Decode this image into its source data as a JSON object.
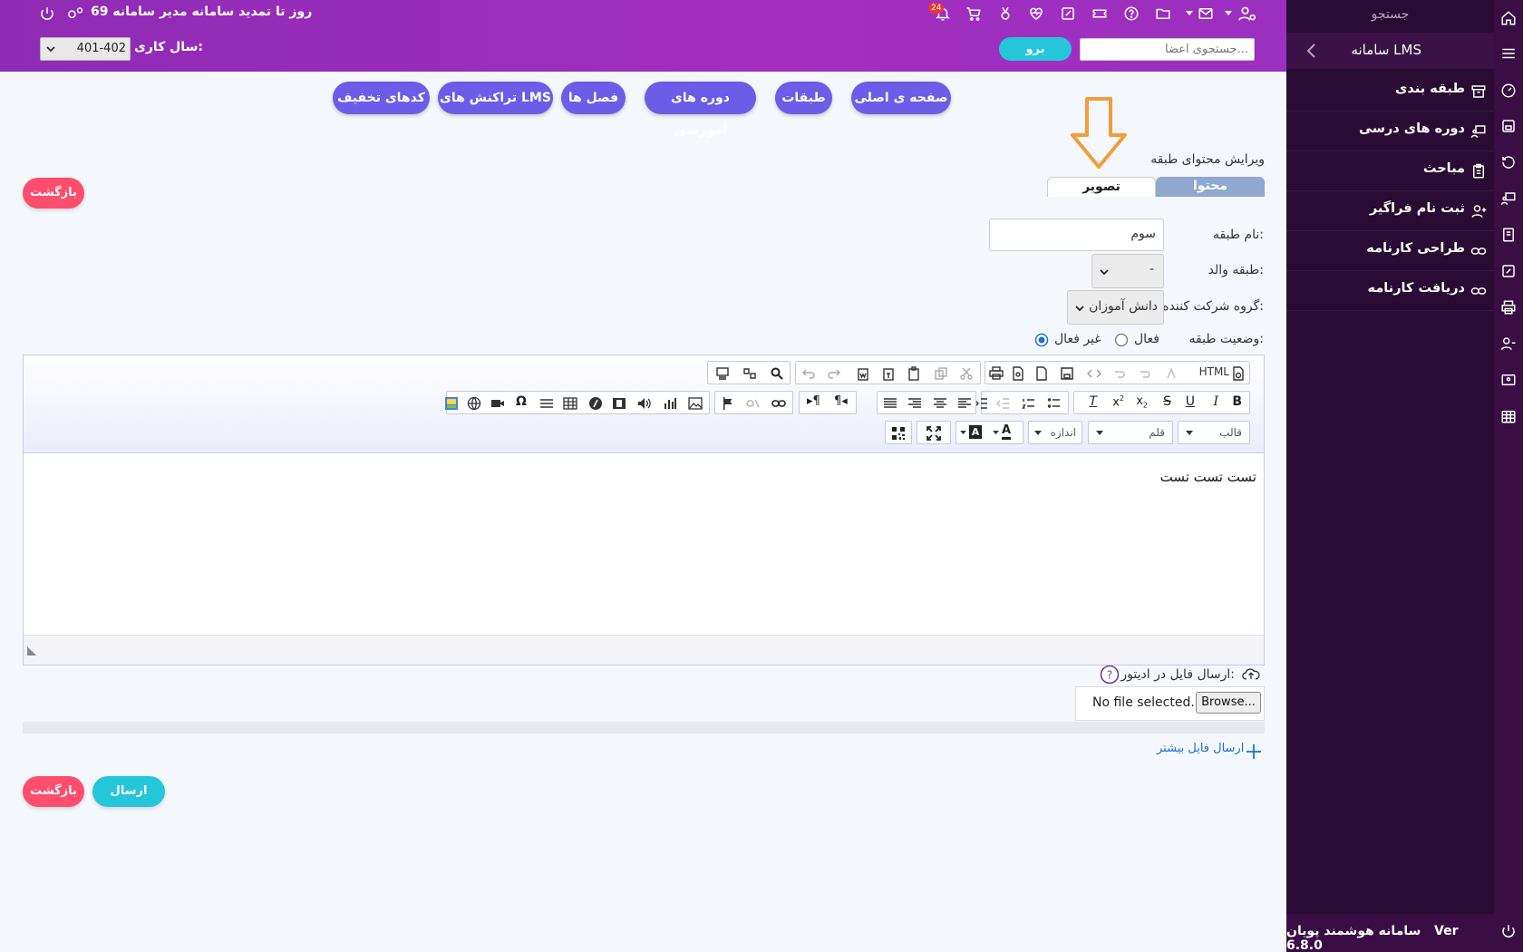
{
  "sidebar": {
    "search_label": "جستجو",
    "title": "سامانه LMS",
    "items": [
      {
        "label": "طبقه بندی",
        "icon": "archive-box-icon"
      },
      {
        "label": "دوره های درسی",
        "icon": "teacher-board-icon"
      },
      {
        "label": "مباحث",
        "icon": "clipboard-list-icon"
      },
      {
        "label": "ثبت نام فراگیر",
        "icon": "user-plus-icon"
      },
      {
        "label": "طراحی کارنامه",
        "icon": "link-icon"
      },
      {
        "label": "دریافت کارنامه",
        "icon": "link-icon"
      }
    ],
    "footer_name": "سامانه هوشمند پویان",
    "footer_version": "Ver 6.8.0"
  },
  "topbar": {
    "renewal_text": "69 روز تا تمدید سامانه مدیر سامانه",
    "notification_count": "24",
    "search_placeholder": "جستجوی اعضا...",
    "go_label": "برو",
    "year_label": "سال کاری:",
    "year_value": "401-402"
  },
  "nav": {
    "home": "صفحه ی اصلی",
    "floors": "طبقات",
    "courses": "دوره های آموزشی",
    "chapters": "فصل ها",
    "transactions": "تراکنش های LMS",
    "discounts": "کدهای تخفیف"
  },
  "form": {
    "section_title": "ویرایش محتوای طبقه",
    "tab_content": "محتوا",
    "tab_image": "تصویر",
    "back_label": "بازگشت",
    "name_label": "نام طبقه:",
    "name_value": "سوم",
    "parent_label": "طبقه والد:",
    "parent_value": "-",
    "group_label": "گروه شرکت کننده:",
    "group_value": "دانش آموزان",
    "status_label": "وضعیت طبقه:",
    "status_active": "فعال",
    "status_inactive": "غیر فعال",
    "editor_content": "تست تست تست",
    "editor_html_label": "HTML",
    "combo_style": "قالب",
    "combo_font": "قلم",
    "combo_size": "اندازه",
    "upload_label": "ارسال فایل در ادیتور:",
    "no_file": "No file selected.",
    "browse_label": "Browse...",
    "more_files": "ارسال فایل بیشتر",
    "submit_label": "ارسال",
    "back_label_bottom": "بازگشت"
  },
  "colors": {
    "topbar": "#9b2fbf",
    "sidebar": "#2a0b33",
    "pill": "#6c5ce7",
    "danger": "#ff4d6d",
    "info": "#26c6da",
    "arrow": "#f39c3a"
  }
}
